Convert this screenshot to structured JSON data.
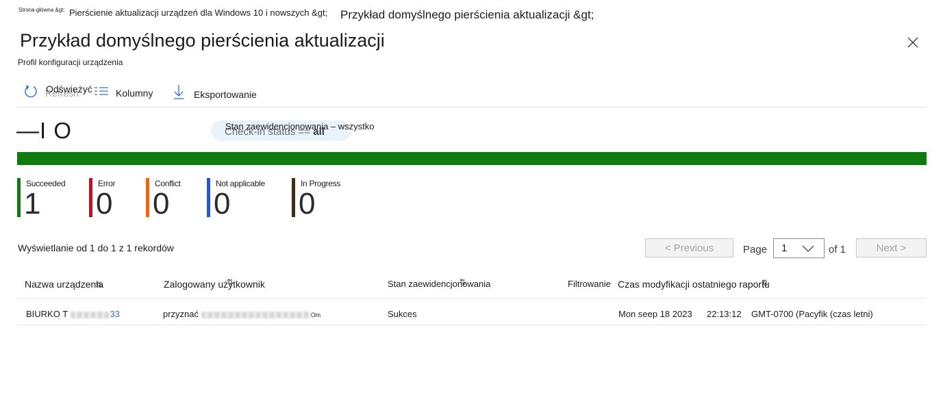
{
  "breadcrumb": {
    "home": "Strona główna &gt;",
    "ring_list": "Pierścienie aktualizacji urządzeń dla Windows 10 i nowszych &gt;",
    "current": "Przykład domyślnego pierścienia aktualizacji &gt;"
  },
  "header": {
    "title": "Przykład domyślnego pierścienia aktualizacji",
    "subtitle": "Profil konfiguracji urządzenia"
  },
  "toolbar": {
    "refresh_label": "Odśwież",
    "refresh_label_suffix": "yć",
    "refresh_ghost": "Refresh",
    "columns_label": "Kolumny",
    "export_label": "Eksportowanie"
  },
  "summary": {
    "total_text": "—I O",
    "filter_ghost_prefix": "Check-in status ",
    "filter_ghost_op": "== ",
    "filter_ghost_value": "all",
    "filter_label": "Stan zaewidencjonowania – wszystko"
  },
  "status_bar_color": "#107c10",
  "stats": [
    {
      "label": "Succeeded",
      "value": "1",
      "color": "#107c10"
    },
    {
      "label": "Error",
      "value": "0",
      "color": "#c50f1f"
    },
    {
      "label": "Conflict",
      "value": "0",
      "color": "#f7630c"
    },
    {
      "label": "Not applicable",
      "value": "0",
      "color": "#2456d6"
    },
    {
      "label": "In Progress",
      "value": "0",
      "color": "#3d3016"
    }
  ],
  "records_text": "Wyświetlanie od 1 do 1 z 1 rekordów",
  "pagination": {
    "previous": "< Previous",
    "page_label": "Page",
    "page_value": "1",
    "of_label": "of 1",
    "next": "Next >"
  },
  "table": {
    "columns": [
      "Nazwa urządzenia",
      "Zalogowany użytkownik",
      "Stan zaewidencjonowania",
      "Filtrowanie",
      "Czas modyfikacji ostatniego raportu"
    ],
    "rows": [
      {
        "device_prefix": "BIURKO T",
        "device_suffix": "33",
        "user_prefix": "przyznać",
        "user_suffix": "Om",
        "status": "Sukces",
        "date": "Mon seep 18 2023",
        "time": "22:13:12",
        "timezone": "GMT-0700 (Pacyfik (czas letni)"
      }
    ]
  }
}
